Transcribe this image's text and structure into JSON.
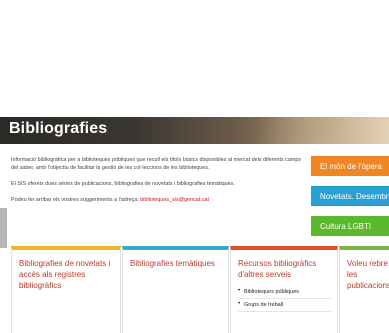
{
  "banner": {
    "title": "Bibliografies"
  },
  "intro": {
    "paragraph1": "Informació bibliogràfica per a biblioteques públiques que recull els títols bàsics disponibles al mercat dels diferents camps del saber, amb l'objectiu de facilitar la gestió de les col·leccions de les biblioteques.",
    "paragraph2": "El SIS ofereix dues sèries de publicacions, bibliografies de novetats i bibliografies temàtiques.",
    "paragraph3_prefix": "Podeu fer arribar els vostres suggeriments a l'adreça: ",
    "email": "biblioteques_sis@gencat.cat"
  },
  "side_buttons": [
    {
      "label": "El món de l'òpera"
    },
    {
      "label": "Novetats. Desembre"
    },
    {
      "label": "Cultura LGBTI"
    }
  ],
  "cards": [
    {
      "title": "Bibliografies de novetats i accés als registres bibliogràfics"
    },
    {
      "title": "Bibliografies temàtiques"
    },
    {
      "title": "Recursos bibliogràfics d'altres serveis",
      "items": [
        "Biblioteques públiques",
        "Grups de treball"
      ]
    },
    {
      "title": "Voleu rebre les publicacions"
    }
  ],
  "colors": {
    "orange": "#f08623",
    "blue": "#2aa0d2",
    "green": "#5cb82e",
    "link_red": "#c0392b"
  }
}
